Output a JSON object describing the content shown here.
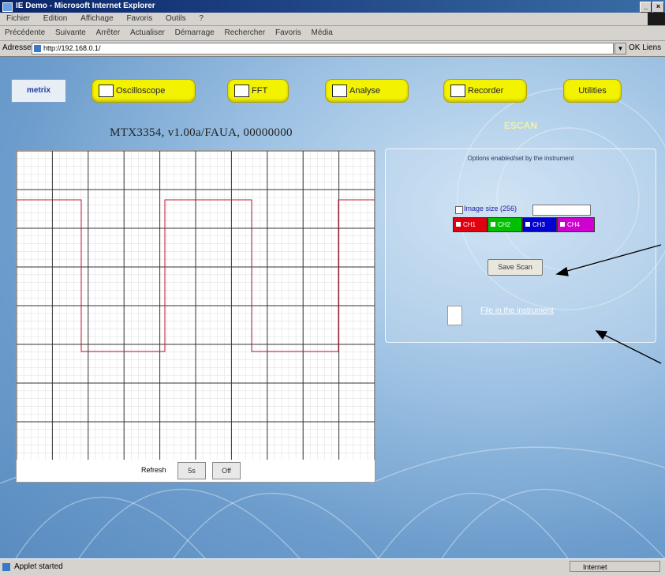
{
  "window": {
    "title": "IE Demo - Microsoft Internet Explorer",
    "buttons": [
      "_",
      "×"
    ]
  },
  "menu": [
    "Fichier",
    "Edition",
    "Affichage",
    "Favoris",
    "Outils",
    "?"
  ],
  "toolbar": [
    "Précédente",
    "Suivante",
    "Arrêter",
    "Actualiser",
    "Démarrage",
    "Rechercher",
    "Favoris",
    "Média"
  ],
  "address": {
    "label": "Adresse",
    "value": "http://192.168.0.1/",
    "go_label": "OK Liens"
  },
  "nav": {
    "logo": "metrix",
    "items": [
      "Oscilloscope",
      "FFT",
      "Analyse",
      "Recorder",
      "Utilities"
    ]
  },
  "scope": {
    "title": "MTX3354, v1.00a/FAUA, 00000000",
    "refresh_label": "Refresh",
    "refresh_buttons": [
      "5s",
      "Off"
    ],
    "trace_color": "#c0162f"
  },
  "panel": {
    "title": "ESCAN",
    "info": "Options enabled/set by the instrument",
    "checkbox_label": "Image size (256)",
    "colors": [
      {
        "label": "CH1",
        "color": "#e00010"
      },
      {
        "label": "CH2",
        "color": "#00c000"
      },
      {
        "label": "CH3",
        "color": "#0000d0"
      },
      {
        "label": "CH4",
        "color": "#d000d0"
      }
    ],
    "save_button": "Save Scan",
    "file_link": "File in the instrument"
  },
  "status": {
    "text": "Applet started",
    "zone": "Internet"
  }
}
